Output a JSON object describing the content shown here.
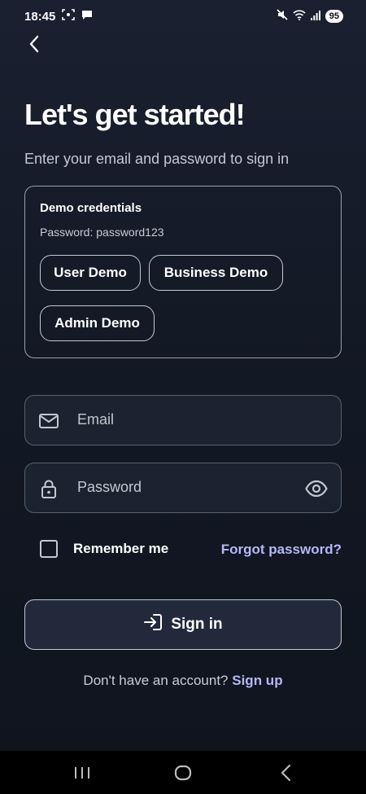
{
  "status_bar": {
    "time": "18:45",
    "battery": "95"
  },
  "screen": {
    "title": "Let's get started!",
    "subtitle": "Enter your email and password to sign in"
  },
  "demo": {
    "title": "Demo credentials",
    "password_hint": "Password: password123",
    "buttons": [
      "User Demo",
      "Business Demo",
      "Admin Demo"
    ]
  },
  "form": {
    "email_placeholder": "Email",
    "password_placeholder": "Password",
    "remember_label": "Remember me",
    "remember_checked": false,
    "forgot_label": "Forgot password?",
    "signin_label": "Sign in"
  },
  "footer": {
    "prompt": "Don't have an account?",
    "signup_label": "Sign up"
  },
  "colors": {
    "accent": "#b5b8f5",
    "background": "#131925"
  },
  "icons": [
    "back-arrow-icon",
    "mail-icon",
    "lock-icon",
    "eye-icon",
    "login-icon"
  ]
}
